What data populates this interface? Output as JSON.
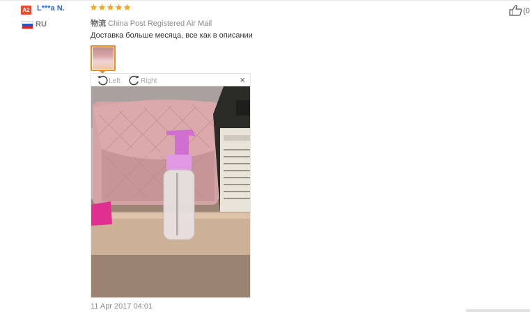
{
  "review": {
    "buyer_level": "A2",
    "buyer_name": "L***a N.",
    "buyer_country_code": "RU",
    "rating": 5,
    "shipping_label": "物流",
    "shipping_method": "China Post Registered Air Mail",
    "text": "Доставка больше месяца, все как в описании",
    "date": "11 Apr 2017 04:01",
    "helpful_count": "(0"
  },
  "image_viewer": {
    "rotate_left_label": "Left",
    "rotate_right_label": "Right",
    "close_label": "×",
    "photo_subject": "pink cosmetic bag with clear pump bottle on shelf"
  },
  "colors": {
    "star": "#f5a623",
    "username": "#2d6ad1",
    "level_badge": "#e94b2f",
    "thumbnail_border": "#f08a22"
  },
  "icons": {
    "star": "star-icon",
    "flag": "russia-flag-icon",
    "rotate_left": "rotate-left-icon",
    "rotate_right": "rotate-right-icon",
    "close": "close-icon",
    "helpful": "thumbs-up-icon"
  }
}
